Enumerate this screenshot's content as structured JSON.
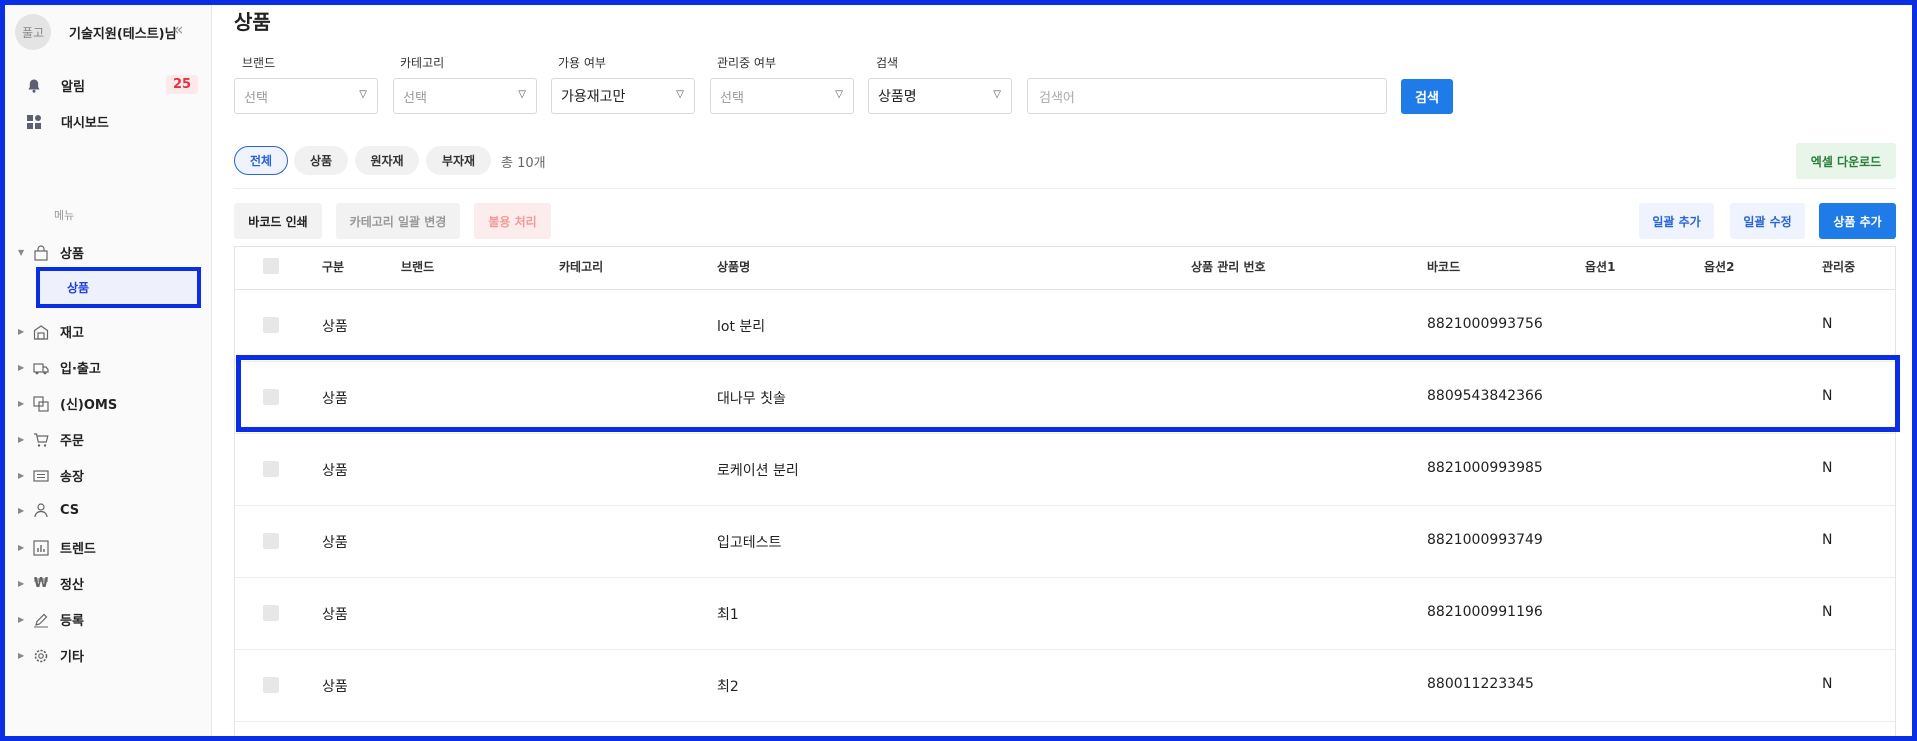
{
  "sidebar": {
    "avatar_text": "풀고",
    "user_name": "기술지원(테스트)님",
    "top_items": [
      {
        "label": "알림",
        "icon": "bell-icon"
      },
      {
        "label": "대시보드",
        "icon": "dashboard-icon"
      }
    ],
    "alert_count": "25",
    "menu_title": "메뉴",
    "items": [
      {
        "label": "상품",
        "icon": "bag-icon",
        "expanded": true
      },
      {
        "label": "재고",
        "icon": "warehouse-icon"
      },
      {
        "label": "입·출고",
        "icon": "truck-icon"
      },
      {
        "label": "(신)OMS",
        "icon": "oms-icon"
      },
      {
        "label": "주문",
        "icon": "cart-icon"
      },
      {
        "label": "송장",
        "icon": "invoice-icon"
      },
      {
        "label": "CS",
        "icon": "person-icon"
      },
      {
        "label": "트렌드",
        "icon": "chart-icon"
      },
      {
        "label": "정산",
        "icon": "won-icon"
      },
      {
        "label": "등록",
        "icon": "pencil-icon"
      },
      {
        "label": "기타",
        "icon": "gear-icon"
      }
    ],
    "sub_item": "상품"
  },
  "page": {
    "title": "상품"
  },
  "filters": {
    "brand": {
      "label": "브랜드",
      "value": "선택"
    },
    "category": {
      "label": "카테고리",
      "value": "선택"
    },
    "availability": {
      "label": "가용 여부",
      "value": "가용재고만"
    },
    "managed": {
      "label": "관리중 여부",
      "value": "선택"
    },
    "search": {
      "label": "검색",
      "value": "상품명",
      "placeholder": "검색어",
      "button": "검색"
    }
  },
  "chips": [
    "전체",
    "상품",
    "원자재",
    "부자재"
  ],
  "total": "총 10개",
  "excel_button": "엑셀 다운로드",
  "actions": {
    "barcode_print": "바코드 인쇄",
    "category_change": "카테고리 일괄 변경",
    "defect": "불용 처리",
    "bulk_add": "일괄 추가",
    "bulk_edit": "일괄 수정",
    "add_product": "상품 추가"
  },
  "table": {
    "headers": [
      "구분",
      "브랜드",
      "카테고리",
      "상품명",
      "상품 관리 번호",
      "바코드",
      "옵션1",
      "옵션2",
      "관리중"
    ],
    "rows": [
      {
        "type": "상품",
        "brand": "",
        "category": "",
        "name": "lot 분리",
        "code": "",
        "barcode": "8821000993756",
        "opt1": "",
        "opt2": "",
        "managed": "N"
      },
      {
        "type": "상품",
        "brand": "",
        "category": "",
        "name": "대나무 칫솔",
        "code": "",
        "barcode": "8809543842366",
        "opt1": "",
        "opt2": "",
        "managed": "N"
      },
      {
        "type": "상품",
        "brand": "",
        "category": "",
        "name": "로케이션 분리",
        "code": "",
        "barcode": "8821000993985",
        "opt1": "",
        "opt2": "",
        "managed": "N"
      },
      {
        "type": "상품",
        "brand": "",
        "category": "",
        "name": "입고테스트",
        "code": "",
        "barcode": "8821000993749",
        "opt1": "",
        "opt2": "",
        "managed": "N"
      },
      {
        "type": "상품",
        "brand": "",
        "category": "",
        "name": "최1",
        "code": "",
        "barcode": "8821000991196",
        "opt1": "",
        "opt2": "",
        "managed": "N"
      },
      {
        "type": "상품",
        "brand": "",
        "category": "",
        "name": "최2",
        "code": "",
        "barcode": "880011223345",
        "opt1": "",
        "opt2": "",
        "managed": "N"
      }
    ]
  },
  "colors": {
    "primary": "#1f7be8",
    "highlight_border": "#0a2ee6",
    "badge_bg": "#fde8ea",
    "badge_text": "#e03344",
    "excel_bg": "#e8f5e9",
    "excel_text": "#2a7d3a"
  }
}
